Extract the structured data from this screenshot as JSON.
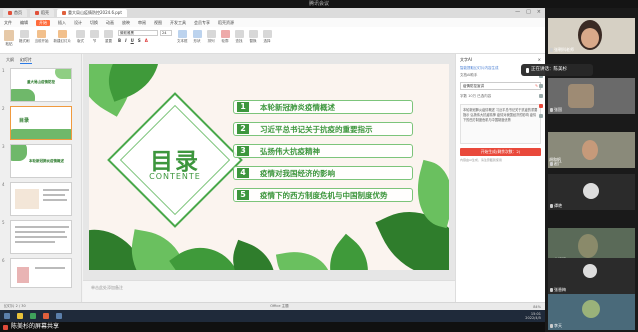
{
  "meeting": {
    "title": "腾讯会议"
  },
  "tabs": [
    {
      "label": "首页",
      "color": "#e0503a"
    },
    {
      "label": "稻壳",
      "color": "#e0503a"
    },
    {
      "label": "重大局山疫情防控2024.6.ppt",
      "color": "#e0603c"
    }
  ],
  "menu": [
    "文件",
    "编辑",
    "开始",
    "插入",
    "设计",
    "切换",
    "动画",
    "放映",
    "审阅",
    "视图",
    "开发工具",
    "会员专享",
    "稻壳资源"
  ],
  "menu_active": "开始",
  "ribbon": {
    "paste": "粘贴",
    "format_painter": "格式刷",
    "current_slide": "当前开始",
    "new_slide": "新建幻灯片",
    "layout": "版式",
    "section": "节",
    "reset": "重置",
    "font_name": "微软雅黑",
    "font_size": "24",
    "textbox": "文本框",
    "shape": "形状",
    "arrange": "排列",
    "outline": "轮廓",
    "find": "查找",
    "replace": "替换",
    "select": "选择"
  },
  "thumb_tabs": {
    "a": "大纲",
    "b": "幻灯片"
  },
  "thumbs": [
    {
      "num": "1",
      "title": "重大局山疫情防控"
    },
    {
      "num": "2",
      "title": "目录"
    },
    {
      "num": "3",
      "title": "本轮新冠肺炎疫情概述"
    },
    {
      "num": "4",
      "title": ""
    },
    {
      "num": "5",
      "title": ""
    },
    {
      "num": "6",
      "title": ""
    }
  ],
  "slide": {
    "title": "目录",
    "subtitle": "CONTENTE",
    "items": [
      {
        "num": "1",
        "text": "本轮新冠肺炎疫情概述"
      },
      {
        "num": "2",
        "text": "习近平总书记关于抗疫的重要指示"
      },
      {
        "num": "3",
        "text": "弘扬伟大抗疫精神"
      },
      {
        "num": "4",
        "text": "疫情对我国经济的影响"
      },
      {
        "num": "5",
        "text": "疫情下的西方制度危机与中国制度优势"
      }
    ]
  },
  "notes": "单击此处添加备注",
  "side": {
    "title": "文字AI",
    "subtitle": "智能提取幻灯片内容生成",
    "label1": "文档AI助手",
    "input": "疫情防控宣讲",
    "label2": "字数 10万 已选内容",
    "textarea": "本轮新冠肺炎疫情概述 习近平总书记关于抗疫的重要指示 弘扬伟大抗疫精神 疫情对我国经济的影响 疫情下的西方制度危机与中国制度优势",
    "button": "开始生成(剩余次数：2)",
    "hint": "内容由AI生成，请注意甄别使用"
  },
  "status": {
    "left": "幻灯片 2 / 30",
    "theme": "Office 主题",
    "zoom": "84%"
  },
  "taskbar": {
    "time": "15:01",
    "date": "2022/4/5"
  },
  "presenter": "陈美杉的屏幕共享",
  "participants": [
    {
      "name": "张朝科老师"
    },
    {
      "name": "张国"
    },
    {
      "name": "赵广"
    },
    {
      "name": "胡和帆"
    },
    {
      "name": "谭艳"
    },
    {
      "name": "金运汉"
    },
    {
      "name": "张香梅"
    },
    {
      "name": "李天"
    }
  ],
  "speaking": "正在讲话：陈美杉"
}
